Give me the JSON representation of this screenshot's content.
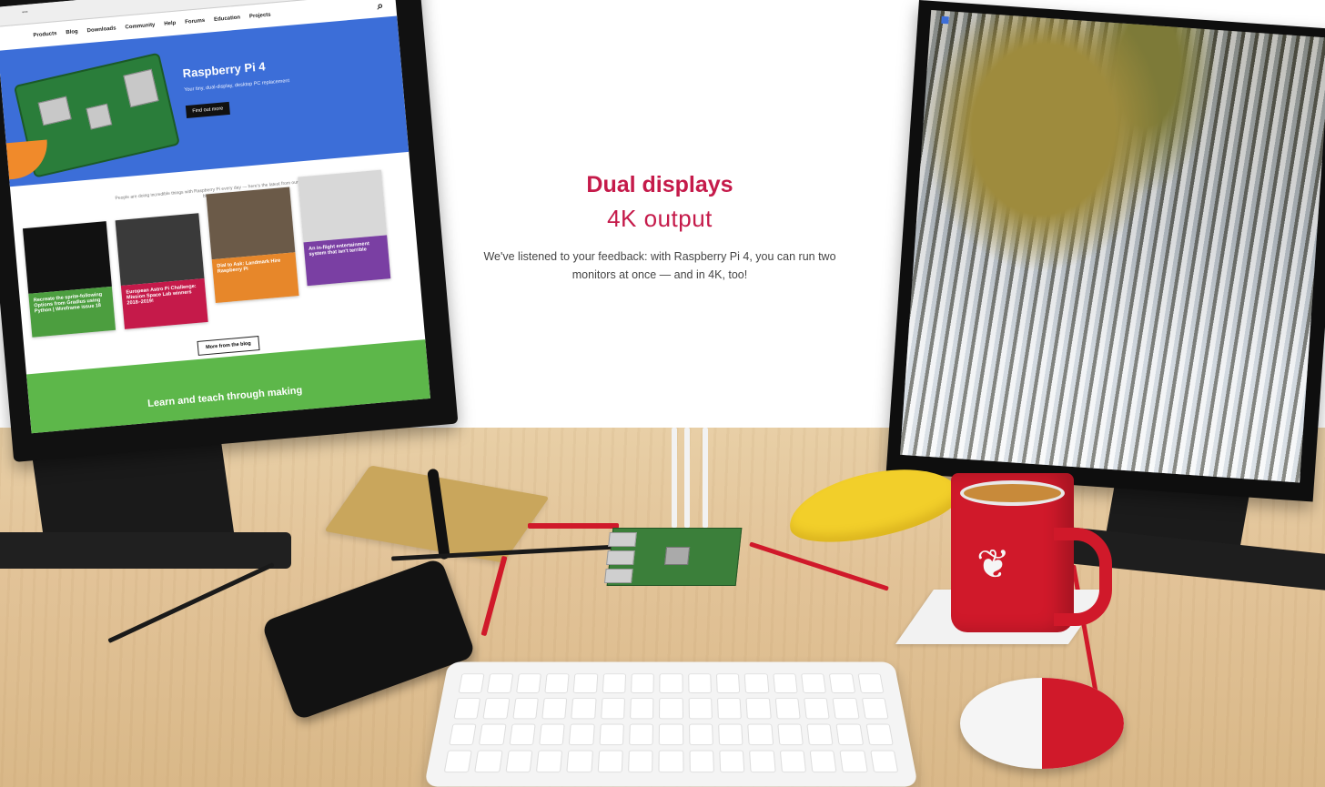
{
  "headline": {
    "title": "Dual displays",
    "subtitle": "4K output"
  },
  "body_text": "We've listened to your feedback: with Raspberry Pi 4, you can run two monitors at once — and in 4K, too!",
  "left_screen": {
    "nav": [
      "Products",
      "Blog",
      "Downloads",
      "Community",
      "Help",
      "Forums",
      "Education",
      "Projects"
    ],
    "hero_title": "Raspberry Pi 4",
    "hero_sub": "Your tiny, dual-display, desktop PC replacement",
    "hero_button": "Find out more",
    "blog_note": "People are doing incredible things with Raspberry Pi every day — here's the latest from our blog",
    "cards": [
      {
        "label": "Recreate the sprite-following Options from Gradius using Python | Wireframe issue 18",
        "color": "#4c9e3f"
      },
      {
        "label": "European Astro Pi Challenge: Mission Space Lab winners 2018–2019!",
        "color": "#c51a4a"
      },
      {
        "label": "Dial to Ask: Landmark Hire Raspberry Pi",
        "color": "#e7872a"
      },
      {
        "label": "An in-flight entertainment system that isn't terrible",
        "color": "#7a3fa3"
      }
    ],
    "more_button": "More from the blog",
    "banner": "Learn and teach through making"
  },
  "colors": {
    "accent": "#c51a4a",
    "hero_blue": "#3c6ed8",
    "band_green": "#5db74a"
  }
}
